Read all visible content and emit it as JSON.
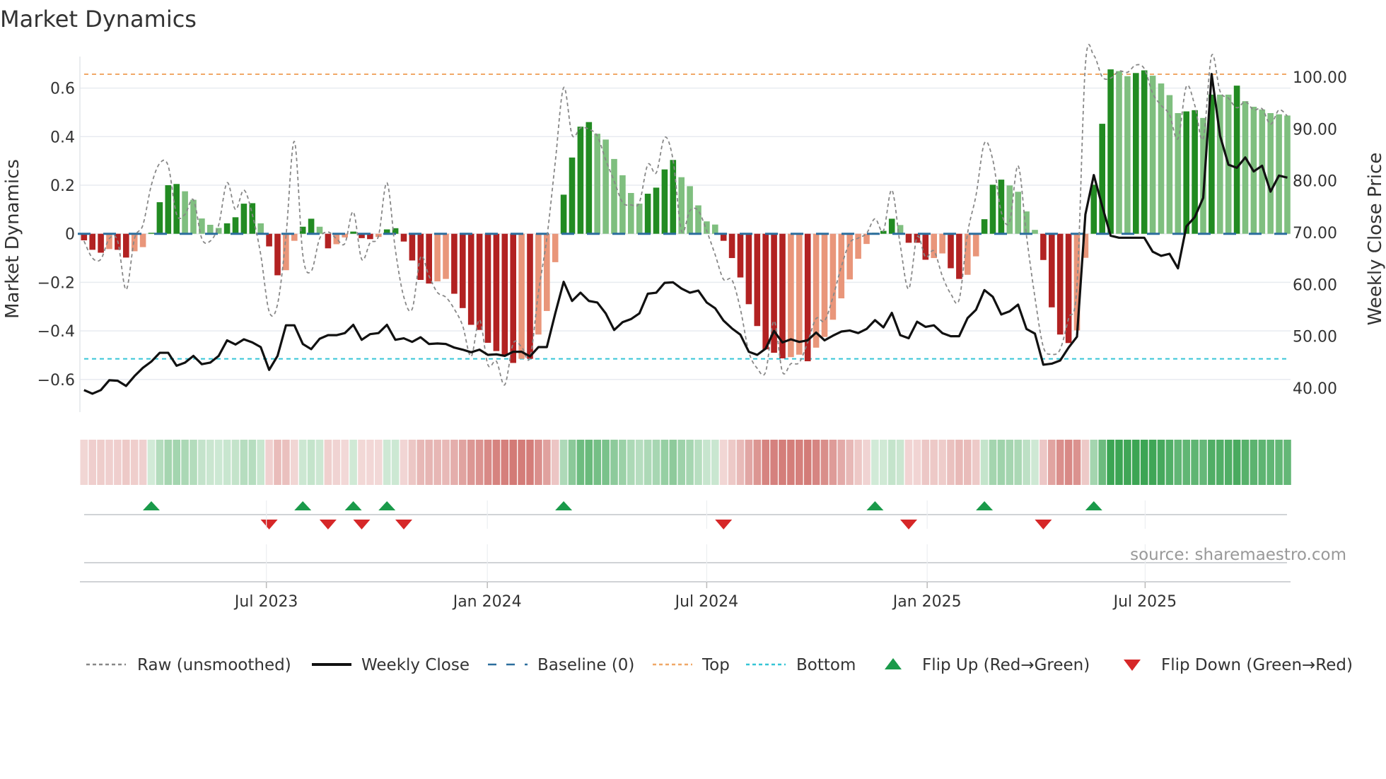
{
  "chart_data": {
    "type": "bar",
    "title": "Market Dynamics",
    "ylabel_left": "Market Dynamics",
    "ylabel_right": "Weekly Close Price",
    "ylim_left": [
      -0.72,
      0.745
    ],
    "ylim_right": [
      34.8,
      104.7
    ],
    "left_ticks": [
      "−0.6",
      "−0.4",
      "−0.2",
      "0",
      "0.2",
      "0.4",
      "0.6"
    ],
    "left_tick_values": [
      -0.6,
      -0.4,
      -0.2,
      0,
      0.2,
      0.4,
      0.6
    ],
    "right_ticks": [
      "40.00",
      "50.00",
      "60.00",
      "70.00",
      "80.00",
      "90.00",
      "100.00"
    ],
    "right_tick_values": [
      40,
      50,
      60,
      70,
      80,
      90,
      100
    ],
    "x_ticks": [
      {
        "label": "Jul 2023",
        "week_index": 21.67
      },
      {
        "label": "Jan 2024",
        "week_index": 47.93
      },
      {
        "label": "Jul 2024",
        "week_index": 74.0
      },
      {
        "label": "Jan 2025",
        "week_index": 100.2
      },
      {
        "label": "Jul 2025",
        "week_index": 126.1
      }
    ],
    "top_level": 0.657,
    "bottom_level": -0.515,
    "baseline": 0,
    "dynamics": [
      -0.027,
      -0.066,
      -0.078,
      -0.063,
      -0.066,
      -0.098,
      -0.072,
      -0.055,
      0.004,
      0.13,
      0.2,
      0.205,
      0.175,
      0.14,
      0.063,
      0.037,
      0.024,
      0.043,
      0.068,
      0.124,
      0.126,
      0.043,
      -0.052,
      -0.171,
      -0.15,
      -0.029,
      0.029,
      0.062,
      0.029,
      -0.06,
      -0.043,
      -0.015,
      0.009,
      -0.018,
      -0.022,
      -0.013,
      0.018,
      0.023,
      -0.032,
      -0.11,
      -0.19,
      -0.205,
      -0.196,
      -0.186,
      -0.247,
      -0.306,
      -0.375,
      -0.396,
      -0.449,
      -0.483,
      -0.5,
      -0.532,
      -0.515,
      -0.515,
      -0.415,
      -0.318,
      -0.117,
      0.161,
      0.314,
      0.441,
      0.46,
      0.412,
      0.388,
      0.308,
      0.241,
      0.168,
      0.124,
      0.165,
      0.19,
      0.265,
      0.304,
      0.233,
      0.196,
      0.117,
      0.051,
      0.038,
      -0.029,
      -0.1,
      -0.18,
      -0.29,
      -0.38,
      -0.476,
      -0.49,
      -0.513,
      -0.508,
      -0.498,
      -0.525,
      -0.469,
      -0.425,
      -0.354,
      -0.266,
      -0.188,
      -0.103,
      -0.042,
      0.004,
      0.012,
      0.062,
      0.036,
      -0.037,
      -0.037,
      -0.107,
      -0.1,
      -0.081,
      -0.142,
      -0.186,
      -0.169,
      -0.093,
      0.06,
      0.202,
      0.223,
      0.199,
      0.173,
      0.092,
      0.016,
      -0.108,
      -0.303,
      -0.415,
      -0.45,
      -0.398,
      -0.099,
      0.202,
      0.453,
      0.677,
      0.67,
      0.649,
      0.662,
      0.673,
      0.651,
      0.619,
      0.571,
      0.497,
      0.504,
      0.509,
      0.477,
      0.573,
      0.573,
      0.573,
      0.61,
      0.546,
      0.523,
      0.512,
      0.497,
      0.492,
      0.487
    ],
    "strengthening": [
      1,
      1,
      1,
      0,
      1,
      1,
      0,
      0,
      1,
      1,
      1,
      1,
      0,
      0,
      0,
      0,
      0,
      1,
      1,
      1,
      1,
      0,
      1,
      1,
      0,
      0,
      1,
      1,
      0,
      1,
      0,
      0,
      1,
      1,
      1,
      0,
      1,
      1,
      1,
      1,
      1,
      1,
      0,
      0,
      1,
      1,
      1,
      1,
      1,
      1,
      1,
      1,
      0,
      1,
      0,
      0,
      0,
      1,
      1,
      1,
      1,
      0,
      0,
      0,
      0,
      0,
      0,
      1,
      1,
      1,
      1,
      0,
      0,
      0,
      0,
      0,
      1,
      1,
      1,
      1,
      1,
      1,
      1,
      1,
      0,
      0,
      1,
      0,
      0,
      0,
      0,
      0,
      0,
      0,
      1,
      1,
      1,
      0,
      1,
      1,
      1,
      0,
      0,
      1,
      1,
      0,
      0,
      1,
      1,
      1,
      0,
      0,
      0,
      0,
      1,
      1,
      1,
      1,
      0,
      0,
      1,
      1,
      1,
      0,
      0,
      1,
      1,
      0,
      0,
      0,
      0,
      1,
      1,
      0,
      1,
      0,
      0,
      1,
      0,
      0,
      0,
      0,
      0,
      0
    ],
    "raw": [
      -0.03,
      -0.1,
      -0.105,
      -0.02,
      -0.03,
      -0.23,
      -0.02,
      0.036,
      0.2,
      0.29,
      0.28,
      0.08,
      0.08,
      0.14,
      -0.02,
      -0.03,
      0.036,
      0.21,
      0.1,
      0.18,
      0.08,
      -0.086,
      -0.32,
      -0.29,
      -0.01,
      0.38,
      -0.086,
      -0.154,
      -0.02,
      0.007,
      -0.02,
      -0.04,
      0.09,
      -0.105,
      -0.037,
      -0.008,
      0.21,
      -0.066,
      -0.26,
      -0.31,
      -0.096,
      -0.174,
      -0.242,
      -0.261,
      -0.31,
      -0.379,
      -0.505,
      -0.354,
      -0.54,
      -0.525,
      -0.622,
      -0.452,
      -0.466,
      -0.51,
      -0.242,
      -0.018,
      0.295,
      0.602,
      0.407,
      0.436,
      0.431,
      0.402,
      0.304,
      0.217,
      0.129,
      0.119,
      0.129,
      0.285,
      0.251,
      0.397,
      0.304,
      0.012,
      0.095,
      0.095,
      0.012,
      -0.086,
      -0.188,
      -0.19,
      -0.31,
      -0.486,
      -0.554,
      -0.569,
      -0.359,
      -0.569,
      -0.535,
      -0.53,
      -0.447,
      -0.349,
      -0.359,
      -0.261,
      -0.135,
      -0.037,
      -0.018,
      0.002,
      0.062,
      0.012,
      0.18,
      -0.047,
      -0.227,
      -0.013,
      -0.096,
      -0.071,
      -0.174,
      -0.247,
      -0.271,
      0.002,
      0.158,
      0.373,
      0.304,
      0.09,
      0.051,
      0.28,
      -0.008,
      -0.261,
      -0.466,
      -0.496,
      -0.476,
      -0.349,
      -0.213,
      0.695,
      0.734,
      0.646,
      0.641,
      0.67,
      0.665,
      0.695,
      0.68,
      0.578,
      0.529,
      0.49,
      0.392,
      0.607,
      0.529,
      0.392,
      0.734,
      0.587,
      0.558,
      0.519,
      0.544,
      0.51,
      0.515,
      0.451,
      0.51,
      0.485
    ],
    "weekly_close": [
      39.6,
      38.9,
      39.6,
      41.5,
      41.4,
      40.4,
      42.3,
      43.9,
      45.1,
      46.8,
      46.8,
      44.3,
      44.9,
      46.2,
      44.6,
      44.9,
      46.2,
      49.2,
      48.4,
      49.4,
      48.8,
      47.9,
      43.5,
      46.2,
      52.1,
      52.1,
      48.5,
      47.5,
      49.5,
      50.2,
      50.2,
      50.6,
      52.2,
      49.3,
      50.4,
      50.6,
      52.2,
      49.3,
      49.6,
      48.9,
      49.8,
      48.5,
      48.6,
      48.5,
      47.8,
      47.4,
      46.9,
      47.4,
      46.4,
      46.5,
      46.2,
      47.0,
      47.0,
      46.1,
      47.9,
      47.9,
      54.4,
      60.5,
      56.8,
      58.4,
      56.8,
      56.5,
      54.4,
      51.2,
      52.7,
      53.3,
      54.4,
      58.2,
      58.4,
      60.3,
      60.4,
      59.2,
      58.4,
      58.8,
      56.5,
      55.4,
      53.0,
      51.5,
      50.3,
      47.0,
      46.4,
      47.6,
      51.0,
      48.8,
      49.4,
      48.9,
      49.2,
      50.7,
      49.2,
      50.1,
      50.9,
      51.1,
      50.6,
      51.4,
      53.1,
      51.7,
      54.5,
      50.2,
      49.6,
      52.8,
      51.8,
      52.1,
      50.6,
      50.0,
      50.0,
      53.5,
      55.1,
      58.9,
      57.6,
      54.2,
      54.8,
      56.1,
      51.4,
      50.5,
      44.5,
      44.7,
      45.3,
      47.8,
      49.9,
      73.5,
      81.1,
      75.1,
      69.4,
      69.0,
      69.0,
      69.0,
      69.0,
      66.3,
      65.5,
      65.9,
      63.1,
      71.2,
      73.0,
      76.7,
      100.6,
      88.7,
      83.1,
      82.5,
      84.5,
      81.8,
      82.9,
      77.9,
      81.0,
      80.6
    ],
    "flip_up_weeks": [
      8,
      26,
      32,
      36,
      57,
      94,
      107,
      120
    ],
    "flip_down_weeks": [
      22,
      29,
      33,
      38,
      76,
      98,
      114
    ],
    "legend": [
      {
        "label": "Raw (unsmoothed)",
        "kind": "dotted",
        "color": "#888888"
      },
      {
        "label": "Weekly Close",
        "kind": "solid",
        "color": "#111111"
      },
      {
        "label": "Baseline (0)",
        "kind": "dashed",
        "color": "#2c6e9e"
      },
      {
        "label": "Top",
        "kind": "dotted",
        "color": "#f0a868"
      },
      {
        "label": "Bottom",
        "kind": "dotted",
        "color": "#36c5d6"
      },
      {
        "label": "Flip Up (Red→Green)",
        "kind": "triangle-up",
        "color": "#1a9a4a"
      },
      {
        "label": "Flip Down (Green→Red)",
        "kind": "triangle-down",
        "color": "#d62728"
      }
    ],
    "legend_position": "bottom",
    "source": "source: sharemaestro.com"
  },
  "colors": {
    "green_strong": "#228b22",
    "green_weak": "#7fbf7f",
    "red_strong": "#b22222",
    "red_weak": "#e9967a",
    "grid": "#e8ebf0",
    "strip_green": "50,160,75",
    "strip_red": "200,90,85"
  }
}
